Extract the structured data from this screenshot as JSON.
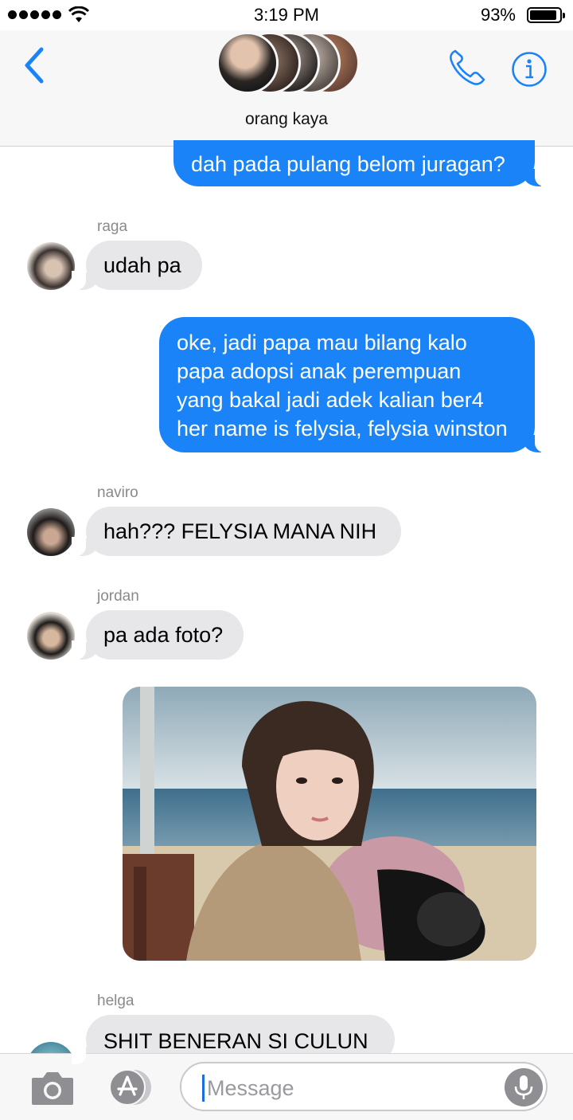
{
  "status_bar": {
    "time": "3:19 PM",
    "battery_percent": "93%",
    "battery_level": 0.93
  },
  "header": {
    "group_name": "orang kaya"
  },
  "messages": [
    {
      "text": "dah pada pulang belom juragan?"
    },
    {
      "sender": "raga",
      "text": "udah pa"
    },
    {
      "lines": [
        "oke, jadi papa mau bilang kalo",
        "papa adopsi anak perempuan",
        "yang bakal jadi adek kalian ber4",
        "her name is felysia, felysia winston"
      ]
    },
    {
      "sender": "naviro",
      "text": "hah??? FELYSIA MANA NIH"
    },
    {
      "sender": "jordan",
      "text": "pa ada foto?"
    },
    {
      "sender": "helga",
      "text": "SHIT BENERAN SI CULUN"
    }
  ],
  "input": {
    "placeholder": "Message"
  },
  "colors": {
    "accent": "#1a83f7",
    "incoming_bubble": "#e7e7ea",
    "sender_label": "#8a8a8e"
  }
}
